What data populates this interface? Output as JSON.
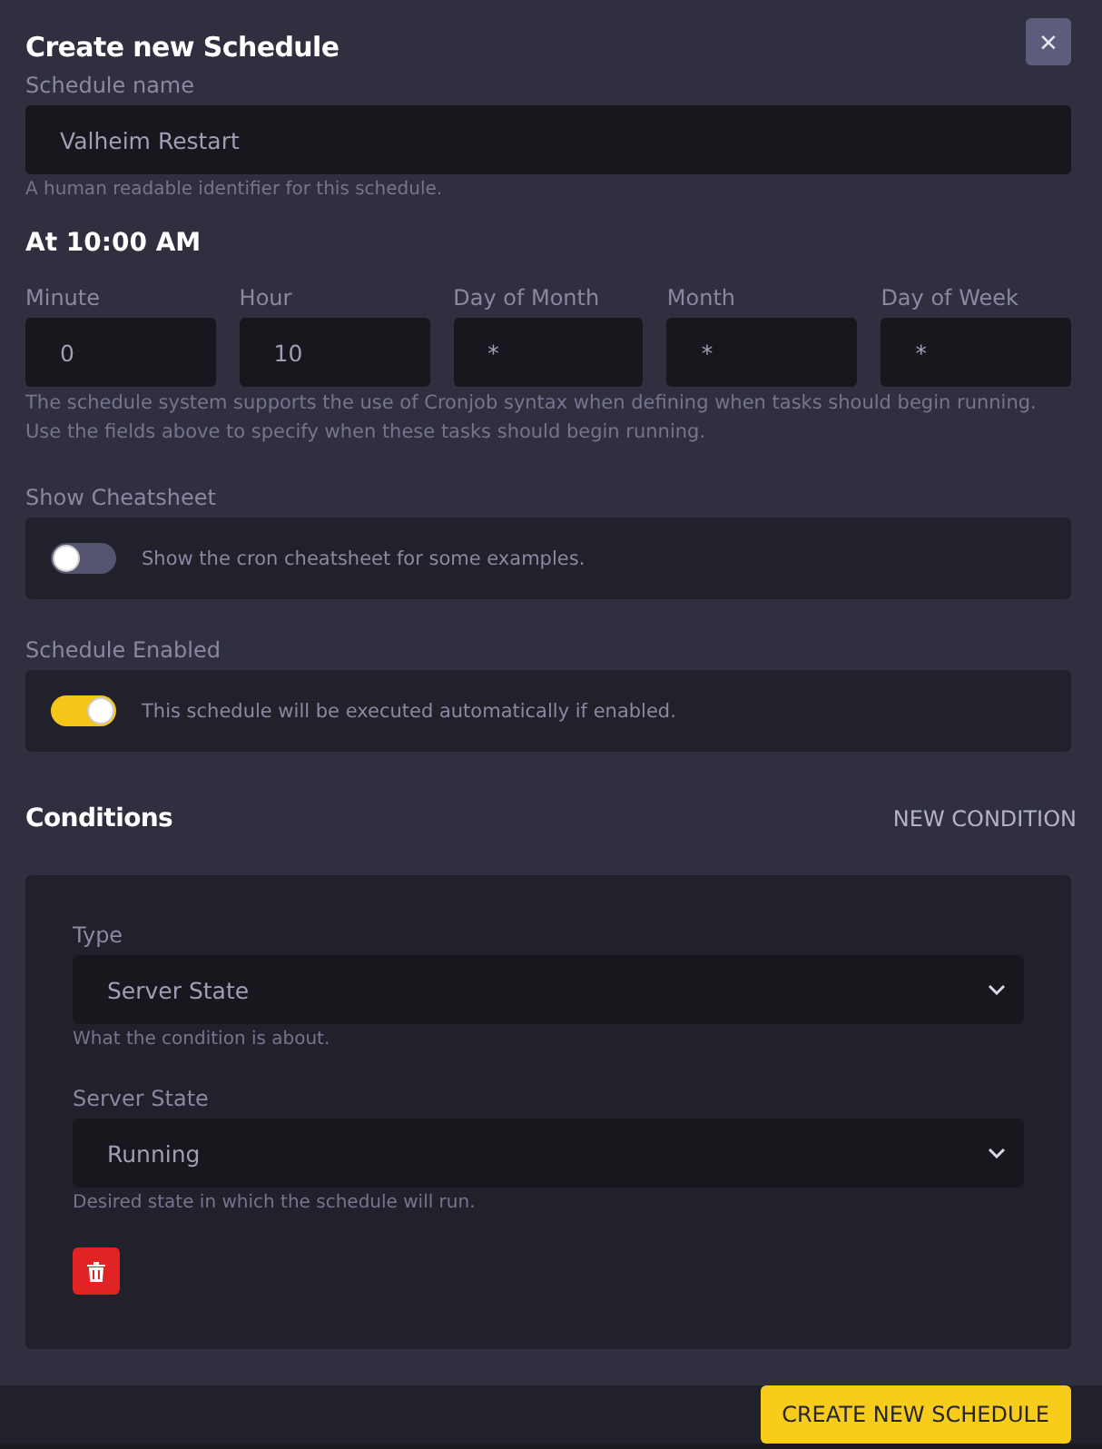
{
  "dialog": {
    "title": "Create new Schedule",
    "close": "×"
  },
  "schedule_name": {
    "label": "Schedule name",
    "value": "Valheim Restart",
    "hint": "A human readable identifier for this schedule."
  },
  "summary": "At 10:00 AM",
  "cron_fields": [
    {
      "label": "Minute",
      "value": "0"
    },
    {
      "label": "Hour",
      "value": "10"
    },
    {
      "label": "Day of Month",
      "value": "*"
    },
    {
      "label": "Month",
      "value": "*"
    },
    {
      "label": "Day of Week",
      "value": "*"
    }
  ],
  "cron_help": "The schedule system supports the use of Cronjob syntax when defining when tasks should begin running. Use the fields above to specify when these tasks should begin running.",
  "toggles": [
    {
      "label": "Show Cheatsheet",
      "description": "Show the cron cheatsheet for some examples.",
      "on": false
    },
    {
      "label": "Schedule Enabled",
      "description": "This schedule will be executed automatically if enabled.",
      "on": true
    }
  ],
  "conditions": {
    "title": "Conditions",
    "new_button": "NEW CONDITION",
    "items": [
      {
        "selects": [
          {
            "label": "Type",
            "value": "Server State",
            "hint": "What the condition is about."
          },
          {
            "label": "Server State",
            "value": "Running",
            "hint": "Desired state in which the schedule will run."
          }
        ]
      }
    ]
  },
  "submit": "CREATE NEW SCHEDULE"
}
